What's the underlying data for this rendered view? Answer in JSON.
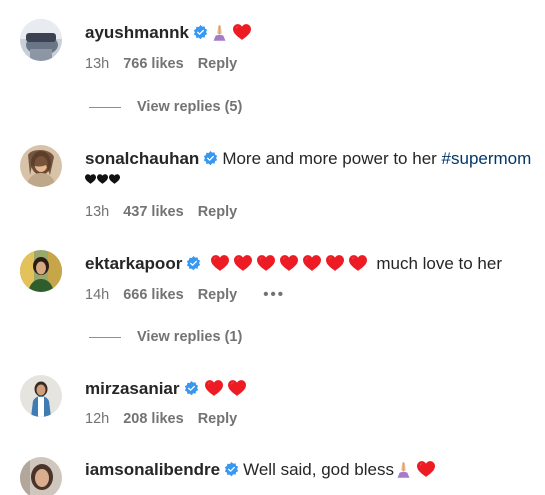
{
  "comments": [
    {
      "username": "ayushmannk",
      "text": "",
      "time": "13h",
      "likes": "766 likes",
      "reply": "Reply",
      "view_replies": "View replies (5)"
    },
    {
      "username": "sonalchauhan",
      "text_before": "More and more power to her ",
      "hashtag": "#supermom",
      "time": "13h",
      "likes": "437 likes",
      "reply": "Reply"
    },
    {
      "username": "ektarkapoor",
      "text": "much love to her",
      "time": "14h",
      "likes": "666 likes",
      "reply": "Reply",
      "more": "•••",
      "view_replies": "View replies (1)"
    },
    {
      "username": "mirzasaniar",
      "time": "12h",
      "likes": "208 likes",
      "reply": "Reply"
    },
    {
      "username": "iamsonalibendre",
      "text": "Well said, god bless"
    }
  ],
  "colors": {
    "verified": "#3897f0",
    "heart": "#ed1c24",
    "hashtag": "#00376b",
    "meta": "#737373"
  }
}
